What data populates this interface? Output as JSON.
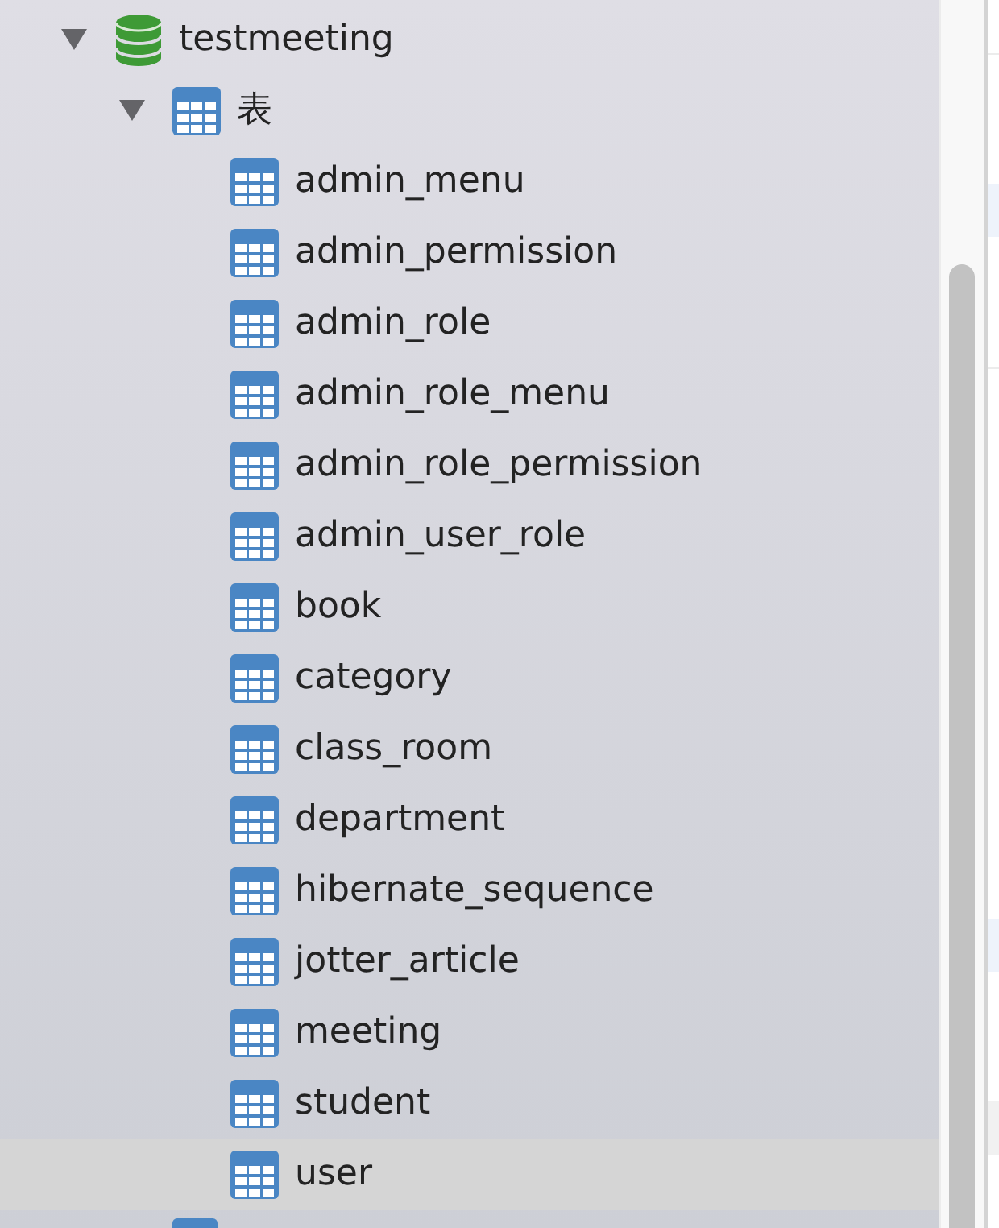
{
  "tree": [
    {
      "kind": "database",
      "label": "testmeeting",
      "expanded": true,
      "selected": false,
      "children": [
        {
          "kind": "folder",
          "label": "表",
          "expanded": true,
          "selected": false,
          "children": [
            {
              "kind": "table",
              "label": "admin_menu",
              "selected": false
            },
            {
              "kind": "table",
              "label": "admin_permission",
              "selected": false
            },
            {
              "kind": "table",
              "label": "admin_role",
              "selected": false
            },
            {
              "kind": "table",
              "label": "admin_role_menu",
              "selected": false
            },
            {
              "kind": "table",
              "label": "admin_role_permission",
              "selected": false
            },
            {
              "kind": "table",
              "label": "admin_user_role",
              "selected": false
            },
            {
              "kind": "table",
              "label": "book",
              "selected": false
            },
            {
              "kind": "table",
              "label": "category",
              "selected": false
            },
            {
              "kind": "table",
              "label": "class_room",
              "selected": false
            },
            {
              "kind": "table",
              "label": "department",
              "selected": false
            },
            {
              "kind": "table",
              "label": "hibernate_sequence",
              "selected": false
            },
            {
              "kind": "table",
              "label": "jotter_article",
              "selected": false
            },
            {
              "kind": "table",
              "label": "meeting",
              "selected": false
            },
            {
              "kind": "table",
              "label": "student",
              "selected": false
            },
            {
              "kind": "table",
              "label": "user",
              "selected": true
            }
          ]
        },
        {
          "kind": "folder"
        }
      ]
    }
  ]
}
